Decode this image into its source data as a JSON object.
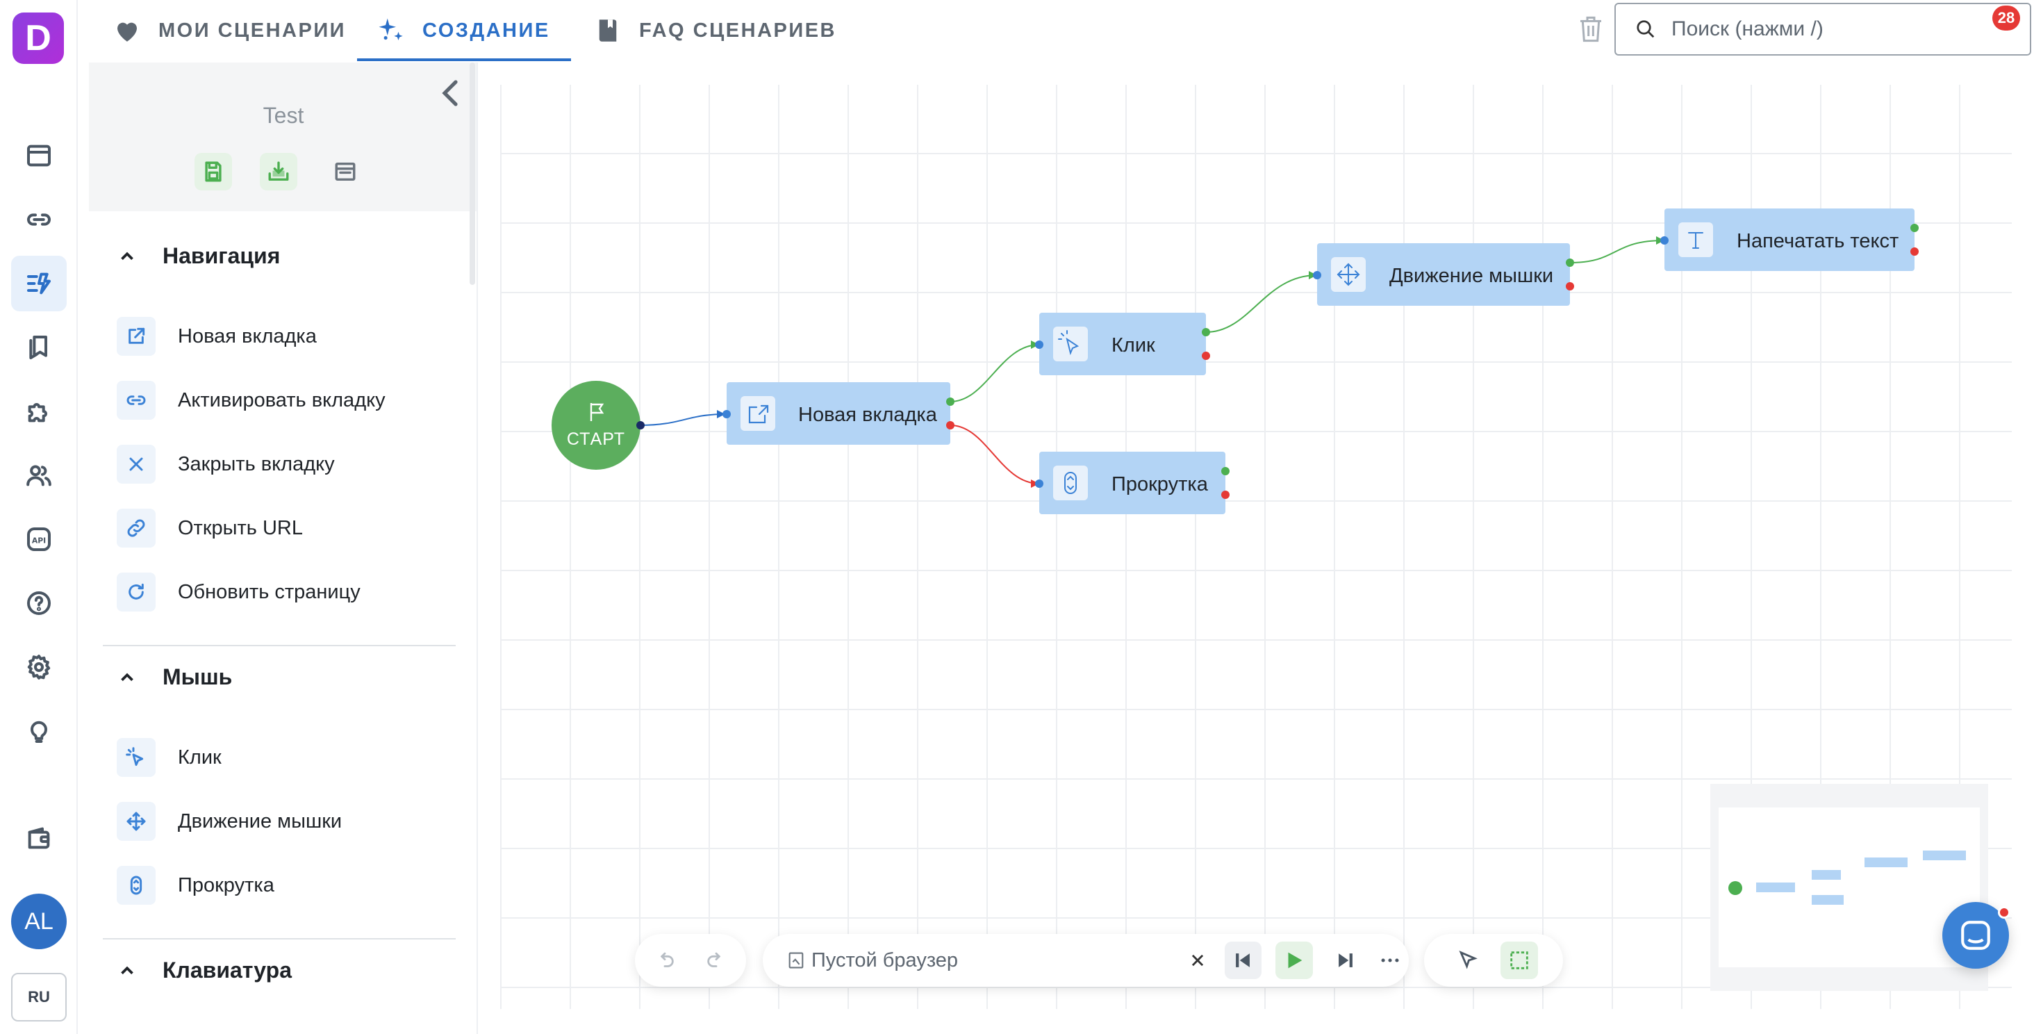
{
  "app": {
    "logo_letter": "D",
    "language": "RU",
    "avatar_initials": "AL",
    "notifications_count": "28"
  },
  "tabs": [
    {
      "label": "МОИ СЦЕНАРИИ"
    },
    {
      "label": "СОЗДАНИЕ"
    },
    {
      "label": "FAQ СЦЕНАРИЕВ"
    }
  ],
  "search": {
    "placeholder": "Поиск (нажми /)"
  },
  "sidebar_icons": [
    "browser-icon",
    "link-icon",
    "scenario-builder-icon",
    "bookmarks-icon",
    "puzzle-icon",
    "users-icon",
    "api-icon",
    "help-icon",
    "settings-icon",
    "lightbulb-icon",
    "wallet-icon"
  ],
  "panel": {
    "project_title": "Test",
    "sections": [
      {
        "title": "Навигация",
        "items": [
          {
            "label": "Новая вкладка",
            "icon": "external-link-icon"
          },
          {
            "label": "Активировать вкладку",
            "icon": "link-icon"
          },
          {
            "label": "Закрыть вкладку",
            "icon": "close-icon"
          },
          {
            "label": "Открыть URL",
            "icon": "url-link-icon"
          },
          {
            "label": "Обновить страницу",
            "icon": "refresh-icon"
          }
        ]
      },
      {
        "title": "Мышь",
        "items": [
          {
            "label": "Клик",
            "icon": "cursor-click-icon"
          },
          {
            "label": "Движение мышки",
            "icon": "move-icon"
          },
          {
            "label": "Прокрутка",
            "icon": "scroll-icon"
          }
        ]
      },
      {
        "title": "Клавиатура",
        "items": []
      }
    ]
  },
  "flow": {
    "start_label": "СТАРТ",
    "nodes": [
      {
        "label": "Новая вкладка",
        "icon": "external-link-icon"
      },
      {
        "label": "Клик",
        "icon": "cursor-click-icon"
      },
      {
        "label": "Прокрутка",
        "icon": "scroll-icon"
      },
      {
        "label": "Движение мышки",
        "icon": "move-icon"
      },
      {
        "label": "Напечатать текст",
        "icon": "text-icon"
      }
    ],
    "colors": {
      "node_bg": "#b3d4f5",
      "success": "#4caf50",
      "error": "#e53935",
      "start": "#5cae5e",
      "accent": "#2b6fc7"
    }
  },
  "toolbar": {
    "browser_label": "Пустой браузер"
  }
}
